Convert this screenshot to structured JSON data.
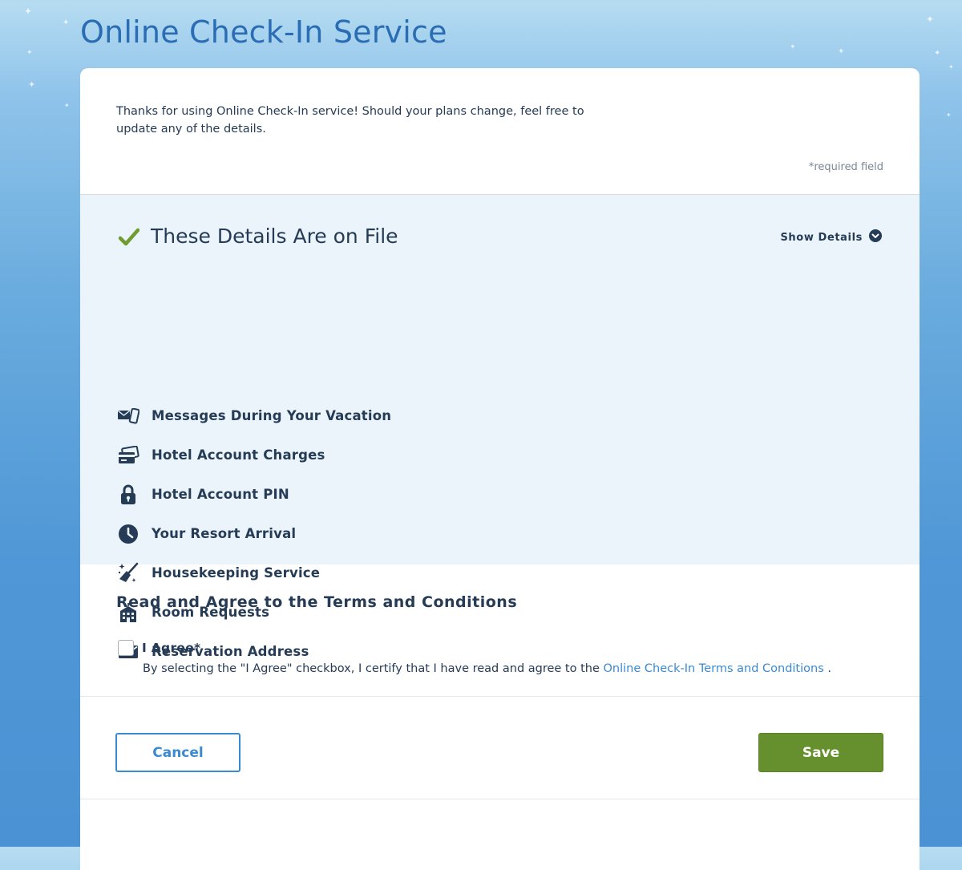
{
  "page": {
    "title": "Online Check-In Service"
  },
  "intro": {
    "text": "Thanks for using Online Check-In service! Should your plans change, feel free to update any of the details.",
    "required_note": "*required field"
  },
  "details": {
    "header": "These Details Are on File",
    "show_details_label": "Show Details",
    "items": [
      {
        "label": "Messages During Your Vacation",
        "icon": "messages-icon"
      },
      {
        "label": "Hotel Account Charges",
        "icon": "credit-cards-icon"
      },
      {
        "label": "Hotel Account PIN",
        "icon": "lock-icon"
      },
      {
        "label": "Your Resort Arrival",
        "icon": "clock-icon"
      },
      {
        "label": "Housekeeping Service",
        "icon": "broom-sparkle-icon"
      },
      {
        "label": "Room Requests",
        "icon": "hotel-building-icon"
      },
      {
        "label": "Reservation Address",
        "icon": "envelope-icon"
      }
    ]
  },
  "terms": {
    "heading": "Read and Agree to the Terms and Conditions",
    "agree_label": "I Agree*",
    "agree_checked": false,
    "description_prefix": "By selecting the \"I Agree\" checkbox, I certify that I have read and agree to the ",
    "link_text": "Online Check-In Terms and Conditions",
    "description_suffix": " ."
  },
  "actions": {
    "cancel_label": "Cancel",
    "save_label": "Save"
  },
  "colors": {
    "title_blue": "#2a6db5",
    "navy_text": "#253b56",
    "link_blue": "#3a8ad2",
    "check_green": "#6e9c2f",
    "save_green": "#66902d",
    "details_bg": "#ebf4fb"
  }
}
